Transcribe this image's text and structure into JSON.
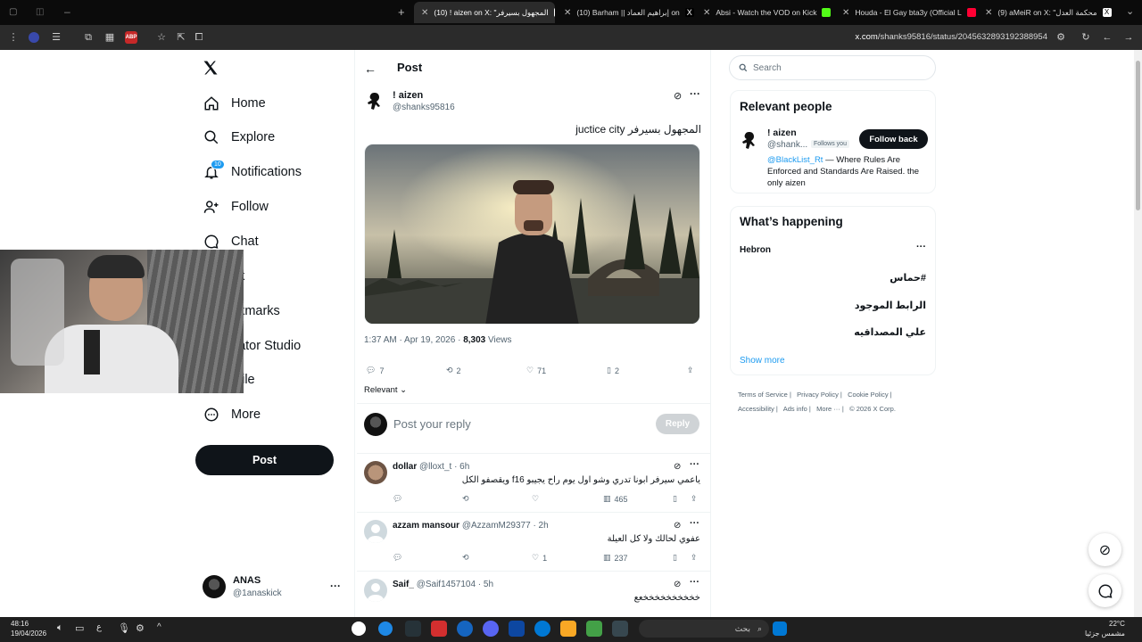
{
  "browser": {
    "tabs": [
      {
        "title": "(10) ! aizen on X: \"المجهول بسيرفر",
        "active": true
      },
      {
        "title": "(10) Barham || إبراهيم العماد on",
        "active": false
      },
      {
        "title": "Absi - Watch the VOD on Kick",
        "active": false
      },
      {
        "title": "Houda - El Gay bta3y (Official L",
        "active": false
      },
      {
        "title": "(9) aMeiR on X: \"محكمة العدل",
        "active": false
      }
    ],
    "url_domain": "x.com",
    "url_path": "/shanks95816/status/2045632893192388954"
  },
  "nav": {
    "items": [
      {
        "label": "Home",
        "icon": "home-icon"
      },
      {
        "label": "Explore",
        "icon": "search-icon"
      },
      {
        "label": "Notifications",
        "icon": "bell-icon",
        "badge": "10"
      },
      {
        "label": "Follow",
        "icon": "follow-icon"
      },
      {
        "label": "Chat",
        "icon": "chat-icon"
      },
      {
        "label": "Grok",
        "visible_text": "ok",
        "icon": "grok-icon"
      },
      {
        "label": "Bookmarks",
        "visible_text": "okmarks",
        "icon": "bookmark-icon"
      },
      {
        "label": "Creator Studio",
        "visible_text": "eator Studio",
        "icon": "creator-studio-icon"
      },
      {
        "label": "Profile",
        "visible_text": "ofile",
        "icon": "profile-icon"
      },
      {
        "label": "More",
        "icon": "more-circle-icon"
      }
    ],
    "post_button": "Post",
    "account": {
      "name": "ANAS",
      "handle": "@1anaskick"
    }
  },
  "main": {
    "header": "Post",
    "post": {
      "author_name": "! aizen",
      "author_handle": "@shanks95816",
      "text": "المجهول بسيرفر juctice city",
      "time": "1:37 AM · Apr 19, 2026",
      "views": "8,303",
      "views_label": "Views",
      "replies": "7",
      "reposts": "2",
      "likes": "71",
      "bookmarks": "2"
    },
    "sort_label": "Relevant",
    "reply_box": {
      "placeholder": "Post your reply",
      "button": "Reply"
    },
    "replies": [
      {
        "name": "dollar",
        "handle": "@lloxt_t",
        "time": "· 6h",
        "text": "ياعمي سيرفر ابونا تدري وشو اول يوم راح يجيبو f16 ويقصفو الكل",
        "likes": "",
        "views": "465"
      },
      {
        "name": "azzam mansour",
        "handle": "@AzzamM29377",
        "time": "· 2h",
        "text": "عفوي لحالك ولا كل العيلة",
        "likes": "1",
        "views": "237"
      },
      {
        "name": "Saif_",
        "handle": "@Saif1457104",
        "time": "· 5h",
        "text": "خخخخخخخخخخعع",
        "likes": "",
        "views": ""
      }
    ]
  },
  "sidebar": {
    "search_placeholder": "Search",
    "relevant_people": {
      "title": "Relevant people",
      "name": "! aizen",
      "handle": "@shank...",
      "follows_you": "Follows you",
      "button": "Follow back",
      "bio_link": "@BlackList_Rt",
      "bio_text": " — Where Rules Are Enforced and Standards Are Raised. the only aizen"
    },
    "whats_happening": {
      "title": "What’s happening",
      "location": "Hebron",
      "trends": [
        "#حماس",
        "الرابط الموجود",
        "علي المصداقيه"
      ],
      "show_more": "Show more"
    },
    "footer": [
      "Terms of Service",
      "Privacy Policy",
      "Cookie Policy",
      "Accessibility",
      "Ads info",
      "More ···",
      "© 2026 X Corp."
    ]
  },
  "taskbar": {
    "time": "48:16",
    "date": "19/04/2026",
    "weather_temp": "22°C",
    "weather_desc": "مشمس جزئيا",
    "search_placeholder": "بحث",
    "lang": "ع"
  },
  "colors": {
    "accent": "#1d9bf0",
    "text": "#0f1419",
    "muted": "#536471",
    "dark": "#0f1419"
  }
}
